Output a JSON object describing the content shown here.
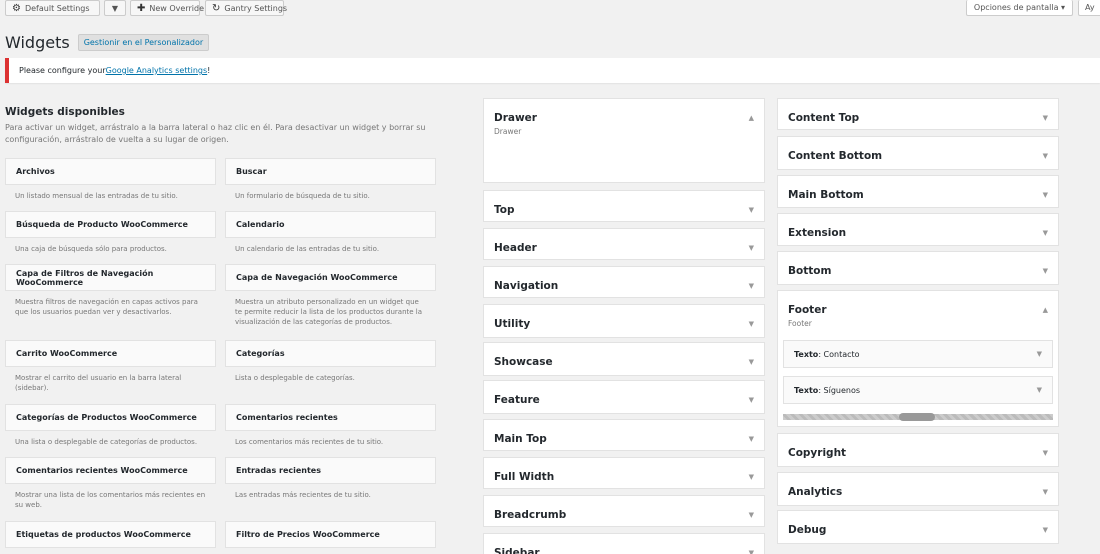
{
  "topbar": {
    "default_settings": "Default Settings",
    "new_override": "New Override",
    "gantry_settings": "Gantry Settings",
    "screen_options": "Opciones de pantalla ▾",
    "help": "Ay"
  },
  "header": {
    "title": "Widgets",
    "customize_label": "Gestionir en el Personalizador"
  },
  "notice": {
    "prefix": "Please configure your ",
    "link": "Google Analytics settings",
    "suffix": "!"
  },
  "available": {
    "title": "Widgets disponibles",
    "description": "Para activar un widget, arrástralo a la barra lateral o haz clic en él. Para desactivar un widget y borrar su configuración, arrástralo de vuelta a su lugar de origen.",
    "widgets": [
      {
        "title": "Archivos",
        "desc": "Un listado mensual de las entradas de tu sitio."
      },
      {
        "title": "Buscar",
        "desc": "Un formulario de búsqueda de tu sitio."
      },
      {
        "title": "Búsqueda de Producto WooCommerce",
        "desc": "Una caja de búsqueda sólo para productos."
      },
      {
        "title": "Calendario",
        "desc": "Un calendario de las entradas de tu sitio."
      },
      {
        "title": "Capa de Filtros de Navegación WooCommerce",
        "desc": "Muestra filtros de navegación en capas activos para que los usuarios puedan ver y desactivarlos."
      },
      {
        "title": "Capa de Navegación WooCommerce",
        "desc": "Muestra un atributo personalizado en un widget que te permite reducir la lista de los productos durante la visualización de las categorías de productos."
      },
      {
        "title": "Carrito WooCommerce",
        "desc": "Mostrar el carrito del usuario en la barra lateral (sidebar)."
      },
      {
        "title": "Categorías",
        "desc": "Lista o desplegable de categorías."
      },
      {
        "title": "Categorías de Productos WooCommerce",
        "desc": "Una lista o desplegable de categorías de productos."
      },
      {
        "title": "Comentarios recientes",
        "desc": "Los comentarios más recientes de tu sitio."
      },
      {
        "title": "Comentarios recientes WooCommerce",
        "desc": "Mostrar una lista de los comentarios más recientes en su web."
      },
      {
        "title": "Entradas recientes",
        "desc": "Las entradas más recientes de tu sitio."
      },
      {
        "title": "Etiquetas de productos WooCommerce",
        "desc": ""
      },
      {
        "title": "Filtro de Precios WooCommerce",
        "desc": ""
      }
    ]
  },
  "sidebars_mid": [
    {
      "title": "Drawer",
      "desc": "Drawer",
      "arrow": "▲"
    },
    {
      "title": "Top",
      "arrow": "▼"
    },
    {
      "title": "Header",
      "arrow": "▼"
    },
    {
      "title": "Navigation",
      "arrow": "▼"
    },
    {
      "title": "Utility",
      "arrow": "▼"
    },
    {
      "title": "Showcase",
      "arrow": "▼"
    },
    {
      "title": "Feature",
      "arrow": "▼"
    },
    {
      "title": "Main Top",
      "arrow": "▼"
    },
    {
      "title": "Full Width",
      "arrow": "▼"
    },
    {
      "title": "Breadcrumb",
      "arrow": "▼"
    },
    {
      "title": "Sidebar",
      "arrow": "▼"
    }
  ],
  "sidebars_right": [
    {
      "title": "Content Top",
      "arrow": "▼"
    },
    {
      "title": "Content Bottom",
      "arrow": "▼"
    },
    {
      "title": "Main Bottom",
      "arrow": "▼"
    },
    {
      "title": "Extension",
      "arrow": "▼"
    },
    {
      "title": "Bottom",
      "arrow": "▼"
    },
    {
      "title": "Footer",
      "desc": "Footer",
      "arrow": "▲",
      "widgets": [
        {
          "prefix": "Texto",
          "name": ": Contacto"
        },
        {
          "prefix": "Texto",
          "name": ": Síguenos"
        }
      ]
    },
    {
      "title": "Copyright",
      "arrow": "▼"
    },
    {
      "title": "Analytics",
      "arrow": "▼"
    },
    {
      "title": "Debug",
      "arrow": "▼"
    }
  ]
}
